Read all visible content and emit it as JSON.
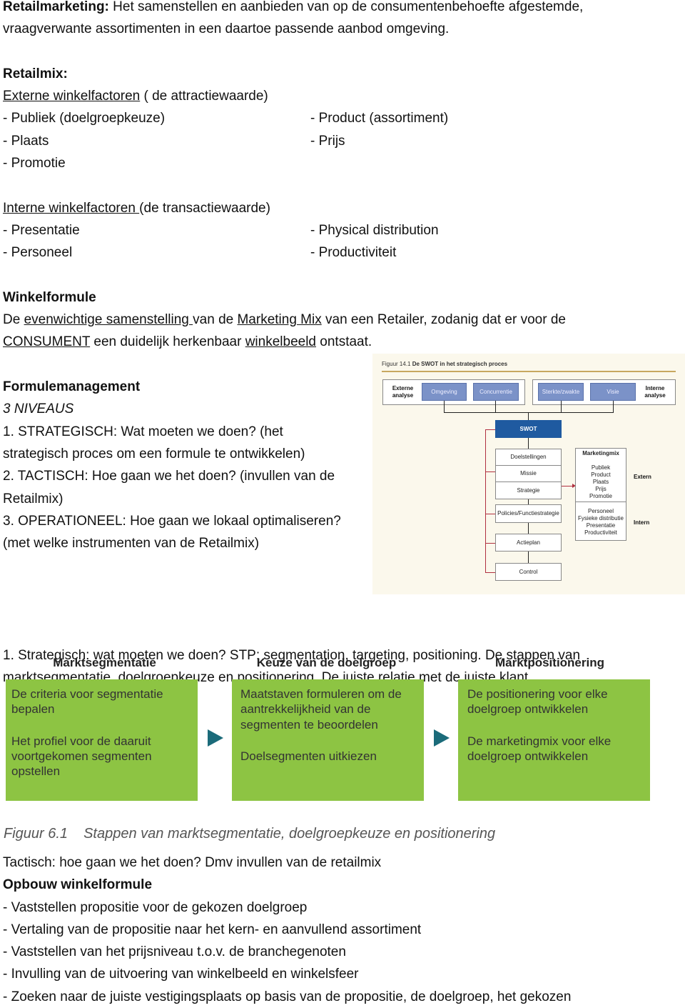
{
  "intro": {
    "term": "Retailmarketing:",
    "line1": " Het samenstellen en aanbieden van op de consumentenbehoefte afgestemde,",
    "line2": "vraagverwante assortimenten in een daartoe passende aanbod omgeving."
  },
  "retailmix": {
    "heading": "Retailmix:",
    "extern_title": "Externe winkelfactoren",
    "extern_suffix": " ( de attractiewaarde)",
    "extern_left": [
      "- Publiek (doelgroepkeuze)",
      "- Plaats",
      "- Promotie"
    ],
    "extern_right": [
      "- Product (assortiment)",
      "- Prijs"
    ],
    "intern_title": "Interne winkelfactoren ",
    "intern_suffix": "(de transactiewaarde)",
    "intern_left": [
      "- Presentatie",
      "- Personeel"
    ],
    "intern_right": [
      "- Physical distribution",
      "- Productiviteit"
    ]
  },
  "winkelformule": {
    "heading": "Winkelformule",
    "t1": "De ",
    "u1": "evenwichtige samenstelling ",
    "t2": "van de ",
    "u2": "Marketing Mix",
    "t3": " van een Retailer, zodanig dat er voor de",
    "u3": "CONSUMENT",
    "t4": " een duidelijk herkenbaar ",
    "u4": "winkelbeeld",
    "t5": " ontstaat."
  },
  "formulemanagement": {
    "heading": "Formulemanagement",
    "sub": "3 NIVEAUS",
    "lines": [
      "1. STRATEGISCH: Wat moeten we doen? (het",
      "strategisch proces om een formule te ontwikkelen)",
      "2. TACTISCH: Hoe gaan we het doen? (invullen van de",
      "Retailmix)",
      "3. OPERATIONEEL: Hoe gaan we lokaal optimaliseren?",
      "(met welke instrumenten van de Retailmix)"
    ]
  },
  "swot_figure": {
    "fig_no": "Figuur 14.1",
    "title": "De SWOT in het strategisch proces",
    "externe": "Externe analyse",
    "interne": "Interne analyse",
    "ext_items": [
      "Omgeving",
      "Concurrentie"
    ],
    "int_items": [
      "Sterkte/zwakte",
      "Visie"
    ],
    "swot": "SWOT",
    "stack": [
      "Doelstellingen",
      "Missie",
      "Strategie"
    ],
    "policies": "Policies/Functiestrategie",
    "actieplan": "Actieplan",
    "control": "Control",
    "mix_title": "Marketingmix",
    "mix_extern": [
      "Publiek",
      "Product",
      "Plaats",
      "Prijs",
      "Promotie"
    ],
    "mix_intern": [
      "Personeel",
      "Fysieke distributie",
      "Presentatie",
      "Productiviteit"
    ],
    "extern": "Extern",
    "intern": "Intern",
    "colors": {
      "swot": "#1f5aa0",
      "blue_box": "#7b92c8",
      "connector_red": "#b03040"
    }
  },
  "strategisch": {
    "line1": "1.  Strategisch: wat moeten we doen? STP: segmentation, targeting, positioning. De stappen van",
    "line2": "marktsegmentatie, doelgroepkeuze en positionering. De juiste relatie met de juiste klant."
  },
  "stp_figure": {
    "columns": [
      {
        "title": "Marktsegmentatie",
        "items": [
          "De criteria voor segmentatie bepalen",
          "Het profiel voor de daaruit voortgekomen segmenten opstellen"
        ]
      },
      {
        "title": "Keuze van de doelgroep",
        "items": [
          "Maatstaven formuleren om de aantrekkelijkheid van de segmenten te beoordelen",
          "Doelsegmenten uitkiezen"
        ]
      },
      {
        "title": "Marktpositionering",
        "items": [
          "De positionering voor elke doelgroep ontwikkelen",
          "De marketingmix voor elke doelgroep ontwikkelen"
        ]
      }
    ],
    "caption_no": "Figuur 6.1",
    "caption": "Stappen van marktsegmentatie, doelgroepkeuze en positionering",
    "colors": {
      "box": "#8dc443",
      "arrow": "#1b6b7a"
    }
  },
  "tactisch": {
    "line": "Tactisch: hoe gaan we het doen? Dmv invullen van de retailmix",
    "heading": "Opbouw winkelformule",
    "items": [
      "- Vaststellen propositie voor de gekozen doelgroep",
      "- Vertaling van de propositie naar het kern- en aanvullend assortiment",
      "- Vaststellen van het prijsniveau t.o.v. de branchegenoten",
      "- Invulling van de uitvoering van winkelbeeld en winkelsfeer",
      "- Zoeken naar de juiste vestigingsplaats op basis van de propositie, de doelgroep, het gekozen"
    ]
  }
}
